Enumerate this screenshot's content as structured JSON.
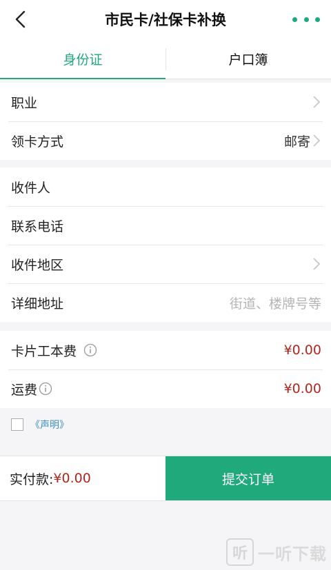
{
  "header": {
    "title": "市民卡/社保卡补换",
    "back_icon": "chevron-left-icon",
    "more_icon": "more-dots-icon",
    "accent": "#20a97a"
  },
  "tabs": [
    {
      "label": "身份证",
      "active": true
    },
    {
      "label": "户口簿",
      "active": false
    }
  ],
  "section1": {
    "occupation_label": "职业",
    "pickup_label": "领卡方式",
    "pickup_value": "邮寄"
  },
  "section2": {
    "recipient_label": "收件人",
    "phone_label": "联系电话",
    "region_label": "收件地区",
    "address_label": "详细地址",
    "address_placeholder": "街道、楼牌号等"
  },
  "section3": {
    "card_fee_label": "卡片工本费",
    "card_fee_value": "¥0.00",
    "shipping_label": "运费",
    "shipping_value": "¥0.00",
    "price_color": "#b3261e"
  },
  "agreement": {
    "checked": false,
    "statement_link": "《声明》"
  },
  "footer": {
    "pay_label": "实付款:",
    "pay_amount": "¥0.00",
    "submit_label": "提交订单"
  },
  "watermark": {
    "mark": "听",
    "text": "一听下载"
  }
}
